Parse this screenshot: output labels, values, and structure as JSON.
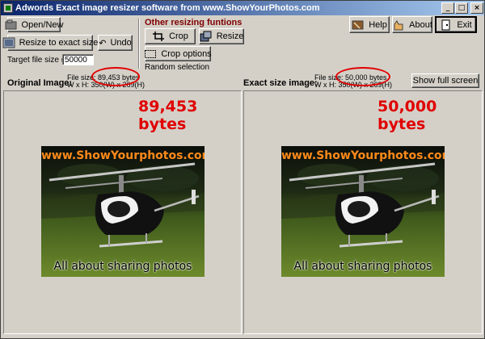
{
  "window": {
    "title": "Adwords Exact image resizer software from www.ShowYourPhotos.com",
    "controls": [
      "_",
      "□",
      "×"
    ]
  },
  "toolbar": {
    "open_new": "Open/New",
    "resize_exact": "Resize to exact size",
    "undo": "Undo",
    "target_label": "Target file size (kb)",
    "target_value": "50000",
    "other_heading": "Other resizing funtions",
    "crop": "Crop",
    "resize": "Resize",
    "crop_options": "Crop options",
    "random_selection": "Random selection",
    "help": "Help",
    "about": "About",
    "exit": "Exit"
  },
  "original": {
    "heading": "Original Image:",
    "file_size_line": "File size: 89,453 bytes",
    "dims_line": "W x H: 350(W) x 269(H)",
    "big_bytes": "89,453 bytes",
    "photo_top": "www.ShowYourphotos.com",
    "photo_bottom": "All about sharing photos"
  },
  "exact": {
    "heading": "Exact size image:",
    "file_size_line": "File size: 50,000 bytes",
    "dims_line": "W x H: 350(W) x 269(H)",
    "big_bytes": "50,000 bytes",
    "photo_top": "www.ShowYourphotos.com",
    "photo_bottom": "All about sharing photos",
    "show_full_screen": "Show full screen"
  },
  "colors": {
    "highlight": "#e00000",
    "title_gradient_start": "#0a246a",
    "watermark": "#ff8a1a"
  }
}
